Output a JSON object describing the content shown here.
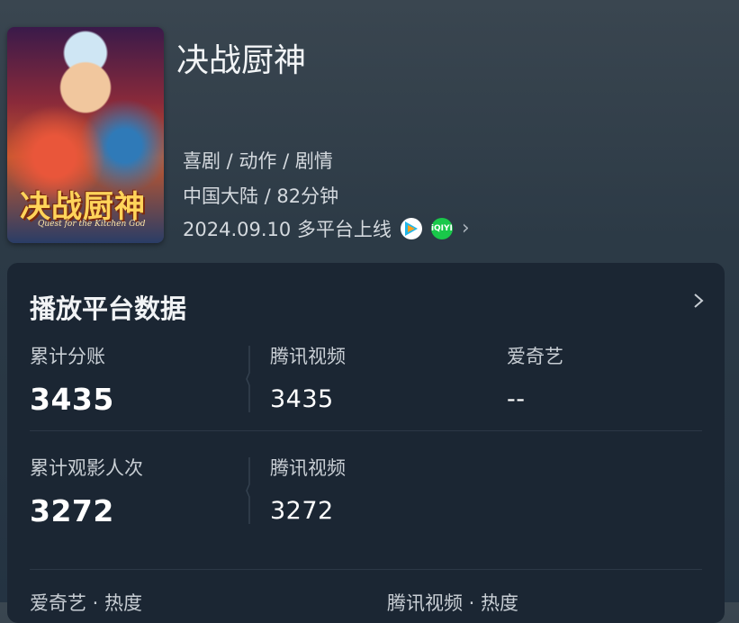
{
  "movie": {
    "title": "决战厨神",
    "genres": "喜剧 / 动作 / 剧情",
    "region_duration": "中国大陆 / 82分钟",
    "release": "2024.09.10 多平台上线",
    "poster_title": "决战厨神",
    "poster_subtitle": "Quest for the Kitchen God"
  },
  "platforms": {
    "tencent_icon": "tencent-video-icon",
    "iqiyi_icon": "iqiyi-icon",
    "iqiyi_text": "iQIYI"
  },
  "card": {
    "title": "播放平台数据",
    "row1": {
      "total_label": "累计分账",
      "total_value": "3435",
      "tencent_label": "腾讯视频",
      "tencent_value": "3435",
      "iqiyi_label": "爱奇艺",
      "iqiyi_value": "--"
    },
    "row2": {
      "total_label": "累计观影人次",
      "total_value": "3272",
      "tencent_label": "腾讯视频",
      "tencent_value": "3272"
    },
    "bottom": {
      "left_label": "爱奇艺 · 热度",
      "right_label": "腾讯视频 · 热度"
    }
  }
}
